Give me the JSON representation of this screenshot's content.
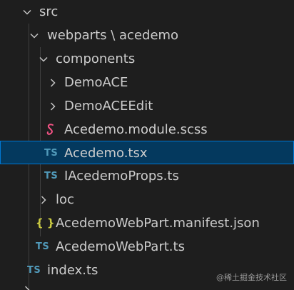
{
  "explorer": {
    "items": [
      {
        "label": "src",
        "kind": "folder",
        "expanded": true,
        "icon": "chevron-down-icon"
      },
      {
        "label": "webparts \\ acedemo",
        "kind": "folder",
        "expanded": true,
        "icon": "chevron-down-icon"
      },
      {
        "label": "components",
        "kind": "folder",
        "expanded": true,
        "icon": "chevron-down-icon"
      },
      {
        "label": "DemoACE",
        "kind": "folder",
        "expanded": false,
        "icon": "chevron-right-icon"
      },
      {
        "label": "DemoACEEdit",
        "kind": "folder",
        "expanded": false,
        "icon": "chevron-right-icon"
      },
      {
        "label": "Acedemo.module.scss",
        "kind": "file",
        "icon": "scss-file-icon"
      },
      {
        "label": "Acedemo.tsx",
        "kind": "file",
        "badge": "TS",
        "icon": "typescript-file-icon",
        "selected": true
      },
      {
        "label": "IAcedemoProps.ts",
        "kind": "file",
        "badge": "TS",
        "icon": "typescript-file-icon"
      },
      {
        "label": "loc",
        "kind": "folder",
        "expanded": false,
        "icon": "chevron-right-icon"
      },
      {
        "label": "AcedemoWebPart.manifest.json",
        "kind": "file",
        "badge": "{ }",
        "icon": "json-file-icon"
      },
      {
        "label": "AcedemoWebPart.ts",
        "kind": "file",
        "badge": "TS",
        "icon": "typescript-file-icon"
      },
      {
        "label": "index.ts",
        "kind": "file",
        "badge": "TS",
        "icon": "typescript-file-icon"
      }
    ]
  },
  "watermark": "@稀土掘金技术社区",
  "colors": {
    "background": "#1e1e1e",
    "selected_background": "#04395e",
    "selected_border": "#0078d4",
    "ts_icon": "#519aba",
    "json_icon": "#cbcb41",
    "scss_icon": "#f55385"
  }
}
